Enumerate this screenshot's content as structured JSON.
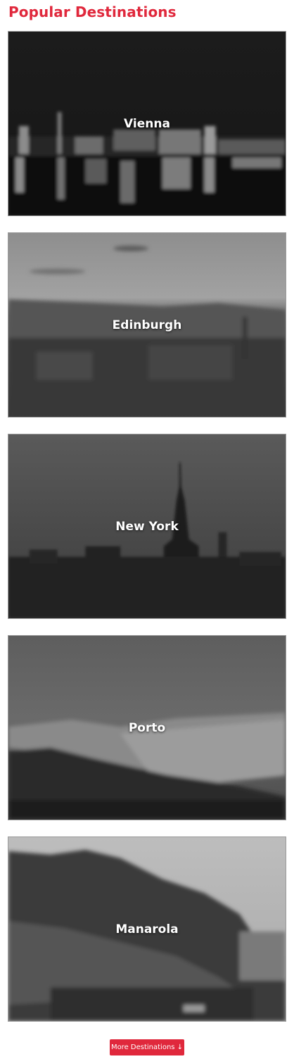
{
  "section": {
    "title": "Popular Destinations"
  },
  "destinations": [
    {
      "name": "Vienna"
    },
    {
      "name": "Edinburgh"
    },
    {
      "name": "New York"
    },
    {
      "name": "Porto"
    },
    {
      "name": "Manarola"
    }
  ],
  "more_button": {
    "label": "More Destinations ↓"
  },
  "colors": {
    "accent": "#e0283c",
    "overlay_text": "#ffffff"
  }
}
